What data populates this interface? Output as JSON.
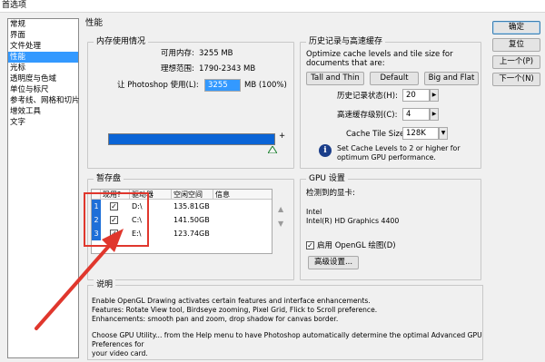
{
  "window": {
    "title": "首选项"
  },
  "nav": {
    "items": [
      {
        "label": "常规"
      },
      {
        "label": "界面"
      },
      {
        "label": "文件处理"
      },
      {
        "label": "性能",
        "selected": true
      },
      {
        "label": "光标"
      },
      {
        "label": "透明度与色域"
      },
      {
        "label": "单位与标尺"
      },
      {
        "label": "参考线、网格和切片"
      },
      {
        "label": "增效工具"
      },
      {
        "label": "文字"
      }
    ]
  },
  "page": {
    "title": "性能"
  },
  "memory": {
    "group_title": "内存使用情况",
    "available_label": "可用内存:",
    "available_value": "3255 MB",
    "ideal_label": "理想范围:",
    "ideal_value": "1790-2343 MB",
    "let_ps_use_label": "让 Photoshop 使用(L):",
    "let_ps_use_value": "3255",
    "let_ps_use_suffix": "MB (100%)",
    "slider_min": "-",
    "slider_max": "+",
    "usage_fraction": 1.0
  },
  "history": {
    "group_title": "历史记录与高速缓存",
    "description": "Optimize cache levels and tile size for documents that are:",
    "preset_buttons": [
      "Tall and Thin",
      "Default",
      "Big and Flat"
    ],
    "history_states_label": "历史记录状态(H):",
    "history_states_value": "20",
    "cache_levels_label": "高速缓存级别(C):",
    "cache_levels_value": "4",
    "tile_size_label": "Cache Tile Size:",
    "tile_size_value": "128K",
    "tip": "Set Cache Levels to 2 or higher for optimum GPU performance."
  },
  "scratch": {
    "group_title": "暂存盘",
    "columns": [
      "现用?",
      "驱动器",
      "空闲空间",
      "信息"
    ],
    "rows": [
      {
        "index": "1",
        "active": true,
        "drive": "D:\\",
        "free": "135.81GB",
        "info": ""
      },
      {
        "index": "2",
        "active": true,
        "drive": "C:\\",
        "free": "141.50GB",
        "info": ""
      },
      {
        "index": "3",
        "active": true,
        "drive": "E:\\",
        "free": "123.74GB",
        "info": ""
      }
    ]
  },
  "gpu": {
    "group_title": "GPU 设置",
    "detected_label": "检测到的显卡:",
    "vendor": "Intel",
    "model": "Intel(R) HD Graphics 4400",
    "enable_label": "启用 OpenGL 绘图(D)",
    "enable_checked": true,
    "advanced_button": "高级设置..."
  },
  "description": {
    "group_title": "说明",
    "lines": [
      "Enable OpenGL Drawing activates certain features and interface enhancements.",
      "Features: Rotate View tool, Birdseye zooming, Pixel Grid, Flick to Scroll preference.",
      "Enhancements: smooth pan and zoom, drop shadow for canvas border.",
      "",
      "Choose GPU Utility... from the Help menu to have Photoshop automatically determine the optimal Advanced GPU Preferences for",
      "your video card."
    ]
  },
  "buttons": {
    "ok": "确定",
    "reset": "复位",
    "prev": "上一个(P)",
    "next": "下一个(N)"
  },
  "icons": {
    "info": "info-icon",
    "spin_right": "spin-right-icon",
    "dropdown": "chevron-down-icon",
    "move_up": "move-up-icon",
    "move_down": "move-down-icon",
    "annotation_arrow": "red-arrow"
  },
  "colors": {
    "selection": "#3399ff",
    "bar": "#0a64d6",
    "annotation": "#e0372d"
  }
}
